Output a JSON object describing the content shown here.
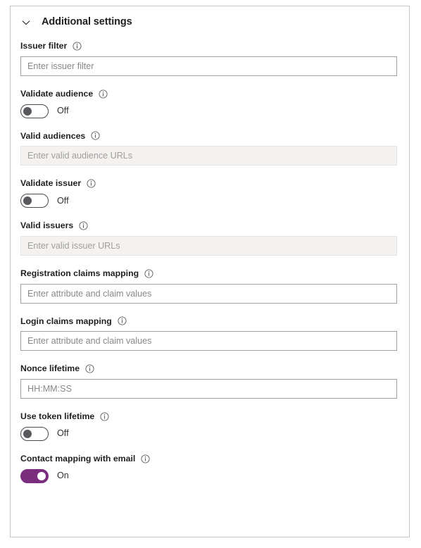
{
  "panel": {
    "header": {
      "title": "Additional settings",
      "chevron_icon": "chevron-down-icon",
      "expanded": true
    },
    "colors": {
      "toggle_on": "#7b2d7e",
      "toggle_off_knob": "#5a585c",
      "label_text": "#201f1e",
      "placeholder": "#8a8886",
      "disabled_background": "#f3f2f1",
      "border": "#a19f9d",
      "card_border": "#c8c6c4"
    },
    "fields": [
      {
        "id": "issuer-filter",
        "type": "text",
        "label": "Issuer filter",
        "info_icon": "info-icon",
        "placeholder": "Enter issuer filter",
        "value": "",
        "disabled": false
      },
      {
        "id": "validate-audience",
        "type": "toggle",
        "label": "Validate audience",
        "info_icon": "info-icon",
        "state_label": "Off",
        "checked": false
      },
      {
        "id": "valid-audiences",
        "type": "text",
        "label": "Valid audiences",
        "info_icon": "info-icon",
        "placeholder": "Enter valid audience URLs",
        "value": "",
        "disabled": true
      },
      {
        "id": "validate-issuer",
        "type": "toggle",
        "label": "Validate issuer",
        "info_icon": "info-icon",
        "state_label": "Off",
        "checked": false
      },
      {
        "id": "valid-issuers",
        "type": "text",
        "label": "Valid issuers",
        "info_icon": "info-icon",
        "placeholder": "Enter valid issuer URLs",
        "value": "",
        "disabled": true
      },
      {
        "id": "registration-claims-mapping",
        "type": "text",
        "label": "Registration claims mapping",
        "info_icon": "info-icon",
        "placeholder": "Enter attribute and claim values",
        "value": "",
        "disabled": false
      },
      {
        "id": "login-claims-mapping",
        "type": "text",
        "label": "Login claims mapping",
        "info_icon": "info-icon",
        "placeholder": "Enter attribute and claim values",
        "value": "",
        "disabled": false
      },
      {
        "id": "nonce-lifetime",
        "type": "text",
        "label": "Nonce lifetime",
        "info_icon": "info-icon",
        "placeholder": "HH:MM:SS",
        "value": "",
        "disabled": false
      },
      {
        "id": "use-token-lifetime",
        "type": "toggle",
        "label": "Use token lifetime",
        "info_icon": "info-icon",
        "state_label": "Off",
        "checked": false
      },
      {
        "id": "contact-mapping-with-email",
        "type": "toggle",
        "label": "Contact mapping with email",
        "info_icon": "info-icon",
        "state_label": "On",
        "checked": true
      }
    ]
  }
}
